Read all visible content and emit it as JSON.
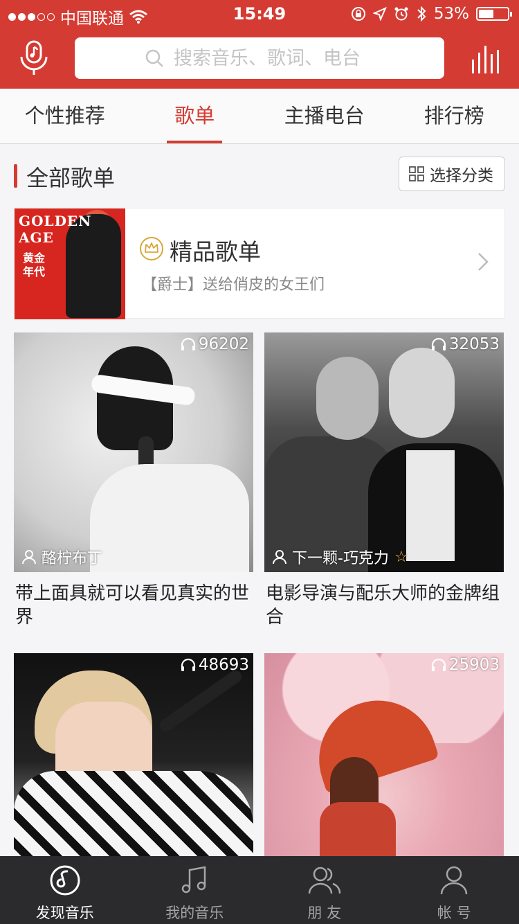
{
  "status_bar": {
    "carrier": "中国联通",
    "time": "15:49",
    "battery": "53%",
    "battery_level": 0.53,
    "signal_full": 3,
    "signal_total": 5
  },
  "header": {
    "search_placeholder": "搜索音乐、歌词、电台",
    "mic_icon": "mic-music-icon",
    "player_icon": "playing-bars-icon"
  },
  "tabs": [
    {
      "label": "个性推荐",
      "active": false
    },
    {
      "label": "歌单",
      "active": true
    },
    {
      "label": "主播电台",
      "active": false
    },
    {
      "label": "排行榜",
      "active": false
    }
  ],
  "section": {
    "title": "全部歌单",
    "category_button": "选择分类"
  },
  "featured": {
    "title": "精品歌单",
    "subtitle": "【爵士】送给俏皮的女王们",
    "cover_text_en": "GOLDEN AGE",
    "cover_text_cn": "黄金年代"
  },
  "playlists": [
    {
      "plays": "96202",
      "author": "酪柠布丁",
      "caption": "带上面具就可以看见真实的世界",
      "starred": false
    },
    {
      "plays": "32053",
      "author": "下一颗-巧克力",
      "caption": "电影导演与配乐大师的金牌组合",
      "starred": true
    },
    {
      "plays": "48693",
      "author": "",
      "caption": "",
      "starred": false
    },
    {
      "plays": "25903",
      "author": "",
      "caption": "",
      "starred": false
    }
  ],
  "bottom_nav": [
    {
      "label": "发现音乐",
      "icon": "netease-logo-icon",
      "active": true
    },
    {
      "label": "我的音乐",
      "icon": "music-note-icon",
      "active": false
    },
    {
      "label": "朋 友",
      "icon": "friends-icon",
      "active": false
    },
    {
      "label": "帐 号",
      "icon": "account-icon",
      "active": false
    }
  ],
  "colors": {
    "brand_red": "#d43c33",
    "nav_bg": "#2b2b2d",
    "crown_gold": "#d9a53a"
  }
}
